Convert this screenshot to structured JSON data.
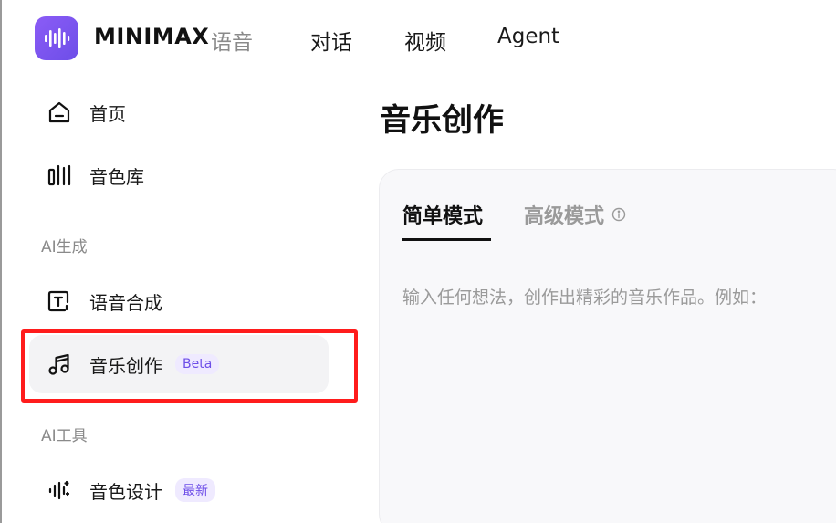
{
  "header": {
    "brand": "MINIMAX",
    "product": "语音",
    "nav": [
      "对话",
      "视频",
      "Agent"
    ]
  },
  "sidebar": {
    "items_top": [
      {
        "label": "首页",
        "icon": "home-icon"
      },
      {
        "label": "音色库",
        "icon": "voice-library-icon"
      }
    ],
    "section_gen": "AI生成",
    "items_gen": [
      {
        "label": "语音合成",
        "icon": "text-to-speech-icon"
      },
      {
        "label": "音乐创作",
        "icon": "music-note-icon",
        "badge": "Beta",
        "active": true
      }
    ],
    "section_tools": "AI工具",
    "items_tools": [
      {
        "label": "音色设计",
        "icon": "voice-design-icon",
        "badge": "最新"
      }
    ]
  },
  "main": {
    "title": "音乐创作",
    "tabs": [
      {
        "label": "简单模式",
        "active": true
      },
      {
        "label": "高级模式",
        "active": false
      }
    ],
    "prompt": "输入任何想法，创作出精彩的音乐作品。例如："
  },
  "colors": {
    "accent": "#6d4ee8",
    "highlight_box": "#ff1c1c",
    "badge_bg": "#efeaff"
  }
}
